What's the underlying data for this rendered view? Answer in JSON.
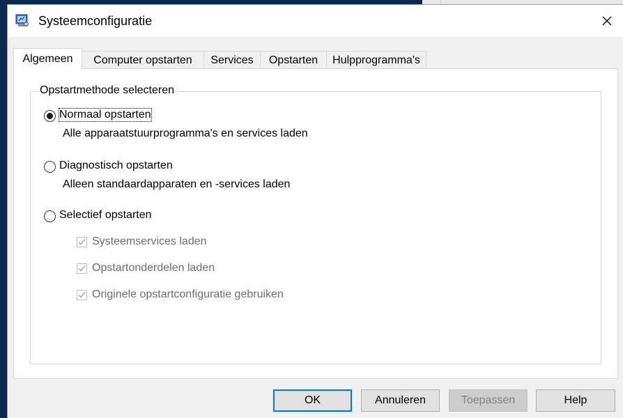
{
  "window": {
    "title": "Systeemconfiguratie"
  },
  "tabs": [
    {
      "label": "Algemeen",
      "active": true
    },
    {
      "label": "Computer opstarten",
      "active": false
    },
    {
      "label": "Services",
      "active": false
    },
    {
      "label": "Opstarten",
      "active": false
    },
    {
      "label": "Hulpprogramma's",
      "active": false
    }
  ],
  "group": {
    "label": "Opstartmethode selecteren",
    "options": [
      {
        "label": "Normaal opstarten",
        "desc": "Alle apparaatstuurprogramma's en services laden",
        "selected": true
      },
      {
        "label": "Diagnostisch opstarten",
        "desc": "Alleen standaardapparaten en -services laden",
        "selected": false
      },
      {
        "label": "Selectief opstarten",
        "selected": false
      }
    ],
    "checkboxes": [
      {
        "label": "Systeemservices laden",
        "checked": true,
        "enabled": false
      },
      {
        "label": "Opstartonderdelen laden",
        "checked": true,
        "enabled": false
      },
      {
        "label": "Originele opstartconfiguratie gebruiken",
        "checked": true,
        "enabled": false
      }
    ]
  },
  "buttons": {
    "ok": "OK",
    "cancel": "Annuleren",
    "apply": "Toepassen",
    "help": "Help"
  },
  "icons": {
    "app": "system-config-icon",
    "close": "close-icon",
    "check": "checkmark-icon"
  },
  "colors": {
    "accent": "#0078d7",
    "disabled_text": "#6d6d6d"
  }
}
